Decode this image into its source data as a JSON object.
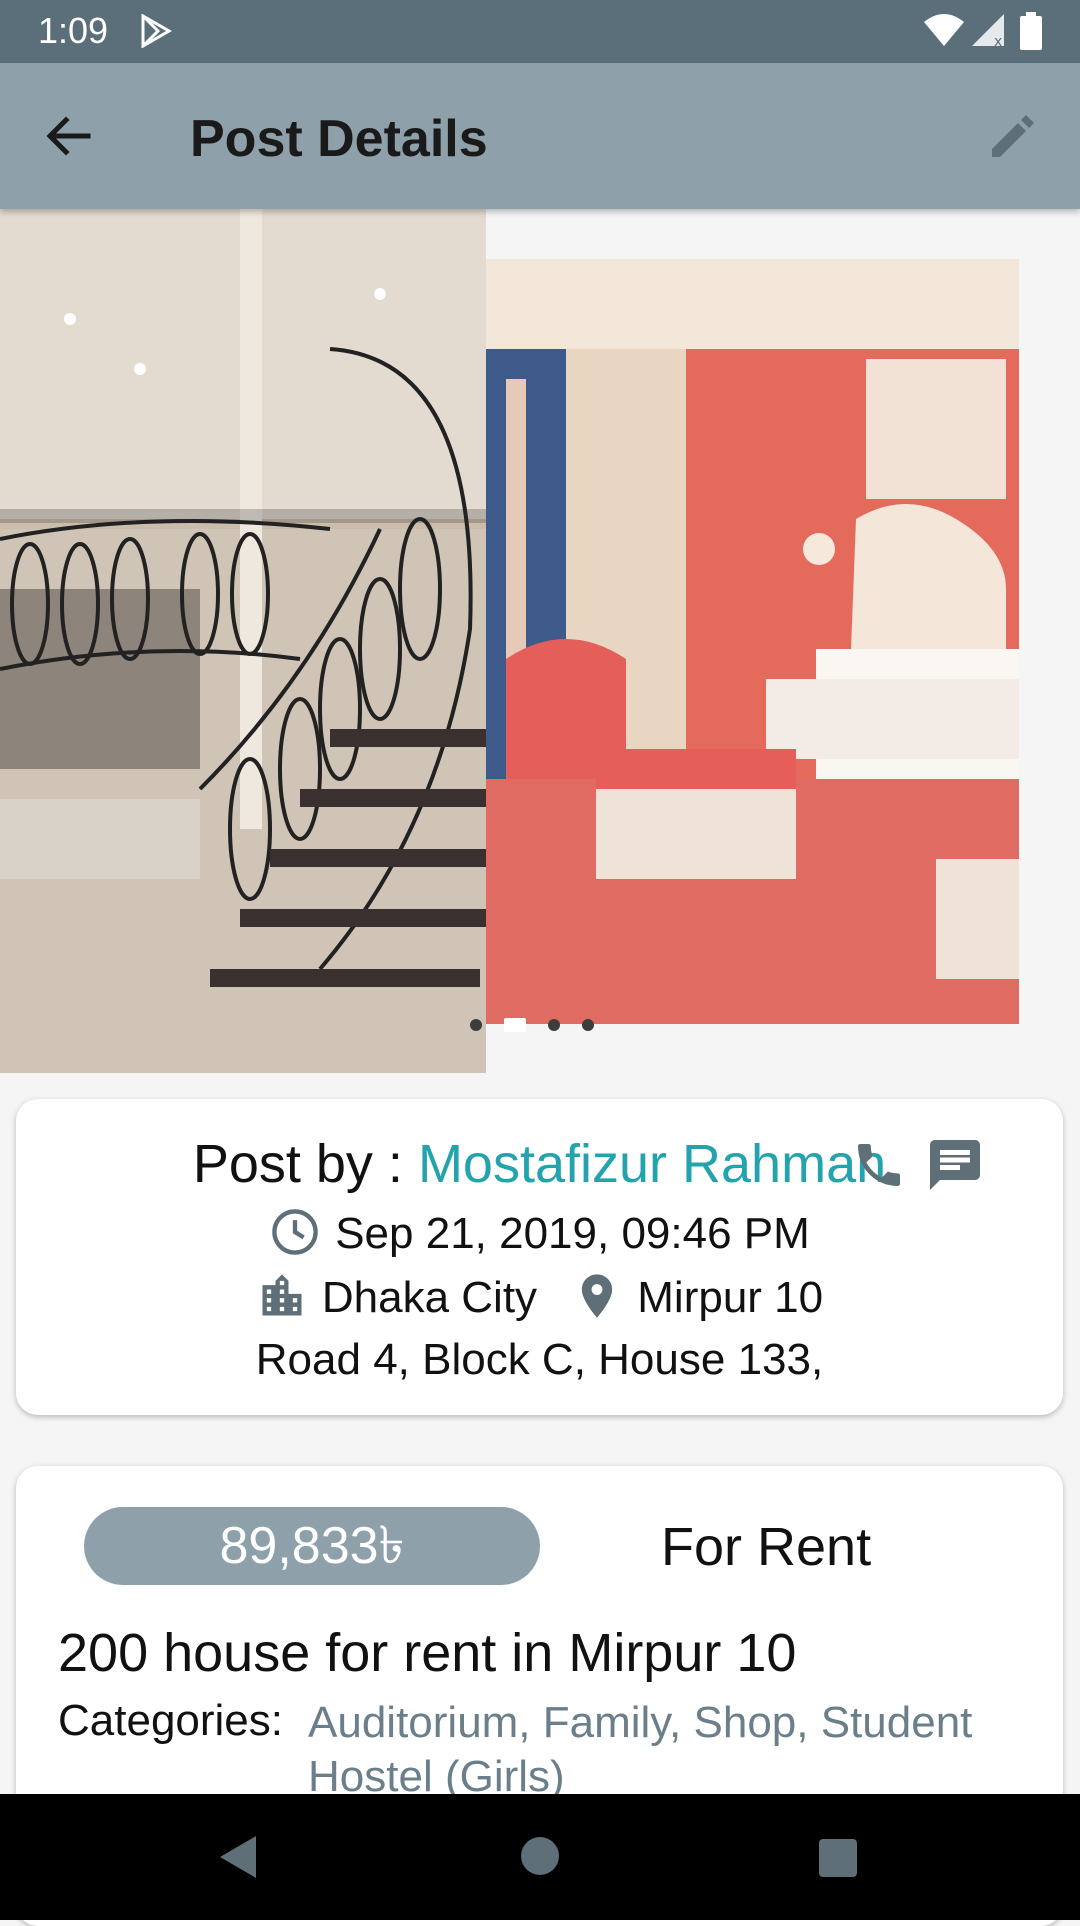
{
  "status_bar": {
    "time": "1:09",
    "icons": [
      "play-store-icon",
      "wifi-icon",
      "signal-icon",
      "battery-icon"
    ]
  },
  "app_bar": {
    "title": "Post Details",
    "back_icon": "arrow-back-icon",
    "edit_icon": "edit-pencil-icon"
  },
  "gallery": {
    "page_count": 4,
    "active_index": 1
  },
  "post_info": {
    "post_by_label": "Post by : ",
    "author": "Mostafizur Rahman",
    "date": "Sep 21, 2019, 09:46 PM",
    "city": "Dhaka City",
    "area": "Mirpur 10",
    "address": "Road 4, Block C, House 133,"
  },
  "listing": {
    "price": "89,833৳",
    "type": "For Rent",
    "headline": "200 house for rent in Mirpur 10",
    "categories_label": "Categories:",
    "categories": "Auditorium, Family, Shop, Student Hostel (Girls)"
  },
  "colors": {
    "status_bar": "#5b6f7b",
    "app_bar": "#8ea0aa",
    "author_link": "#22a3ad",
    "categories": "#6b7f8a"
  }
}
